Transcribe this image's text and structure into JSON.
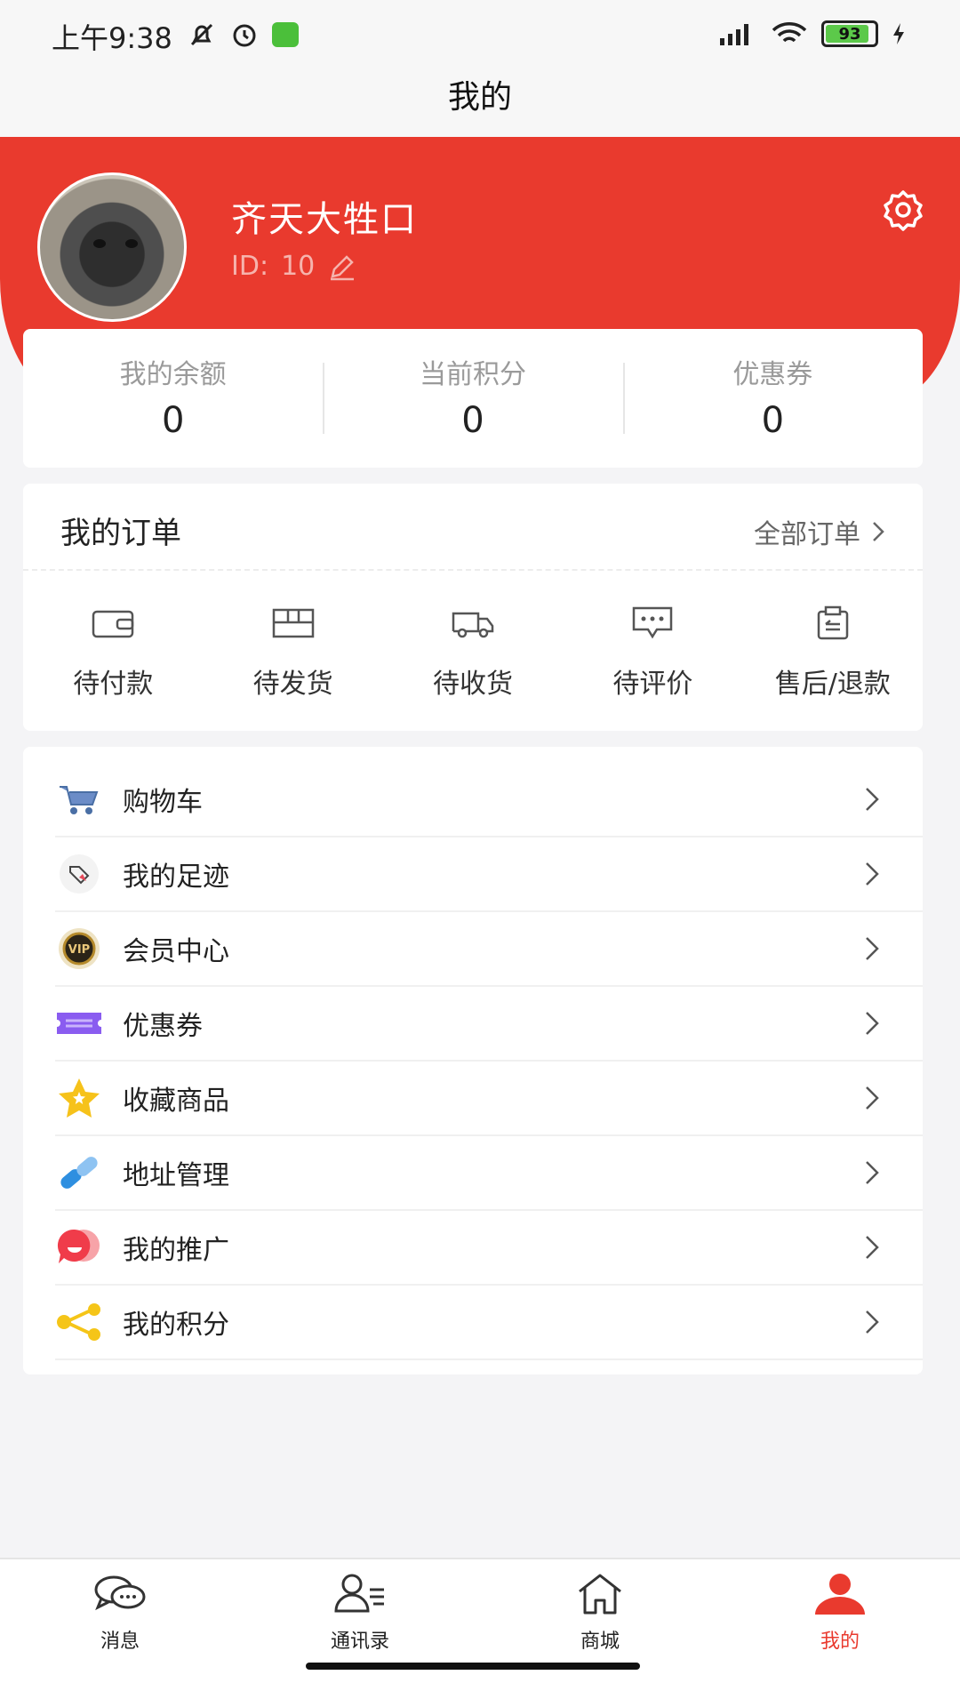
{
  "status_bar": {
    "time": "上午9:38",
    "battery": "93"
  },
  "title": "我的",
  "profile": {
    "username": "齐天大牲口",
    "id_label": "ID:",
    "id_value": "10"
  },
  "stats": [
    {
      "label": "我的余额",
      "value": "0"
    },
    {
      "label": "当前积分",
      "value": "0"
    },
    {
      "label": "优惠券",
      "value": "0"
    }
  ],
  "orders": {
    "title": "我的订单",
    "all_label": "全部订单",
    "items": [
      {
        "label": "待付款",
        "icon": "wallet-icon"
      },
      {
        "label": "待发货",
        "icon": "box-icon"
      },
      {
        "label": "待收货",
        "icon": "truck-icon"
      },
      {
        "label": "待评价",
        "icon": "comment-icon"
      },
      {
        "label": "售后/退款",
        "icon": "return-icon"
      }
    ]
  },
  "menu": [
    {
      "label": "购物车",
      "icon": "cart-icon",
      "color": "#4a6fa5"
    },
    {
      "label": "我的足迹",
      "icon": "tag-icon",
      "color": "#e84a5a"
    },
    {
      "label": "会员中心",
      "icon": "vip-icon",
      "color": "#b58a2b"
    },
    {
      "label": "优惠券",
      "icon": "ticket-icon",
      "color": "#8a5cf0"
    },
    {
      "label": "收藏商品",
      "icon": "star-icon",
      "color": "#f6c21a"
    },
    {
      "label": "地址管理",
      "icon": "link-icon",
      "color": "#2e8fe0"
    },
    {
      "label": "我的推广",
      "icon": "chat-bubble-icon",
      "color": "#f03c4a"
    },
    {
      "label": "我的积分",
      "icon": "share-icon",
      "color": "#f5c518"
    }
  ],
  "bottom_nav": [
    {
      "label": "消息",
      "icon": "message-icon"
    },
    {
      "label": "通讯录",
      "icon": "contacts-icon"
    },
    {
      "label": "商城",
      "icon": "home-icon"
    },
    {
      "label": "我的",
      "icon": "user-icon"
    }
  ],
  "colors": {
    "primary": "#e93a2e",
    "background": "#f4f4f6"
  }
}
